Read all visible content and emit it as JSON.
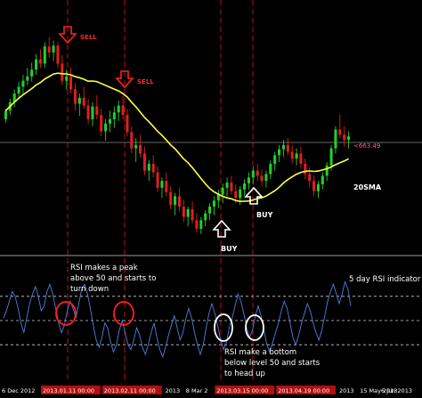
{
  "chart_data": {
    "type": "line",
    "instrument_last_price_label": "<663.49",
    "price_panel": {
      "series": [
        {
          "name": "20SMA",
          "color": "#ffff40"
        }
      ],
      "candles": [
        [
          470,
          482,
          466,
          480
        ],
        [
          480,
          494,
          475,
          490
        ],
        [
          490,
          505,
          484,
          500
        ],
        [
          500,
          514,
          495,
          508
        ],
        [
          508,
          522,
          500,
          515
        ],
        [
          515,
          530,
          510,
          520
        ],
        [
          520,
          536,
          514,
          528
        ],
        [
          528,
          546,
          522,
          540
        ],
        [
          540,
          552,
          530,
          535
        ],
        [
          535,
          560,
          530,
          555
        ],
        [
          555,
          566,
          542,
          548
        ],
        [
          548,
          562,
          538,
          556
        ],
        [
          556,
          560,
          530,
          535
        ],
        [
          535,
          545,
          510,
          515
        ],
        [
          515,
          528,
          505,
          520
        ],
        [
          520,
          530,
          500,
          505
        ],
        [
          505,
          512,
          480,
          488
        ],
        [
          488,
          500,
          474,
          495
        ],
        [
          495,
          508,
          482,
          486
        ],
        [
          486,
          494,
          465,
          470
        ],
        [
          470,
          490,
          462,
          485
        ],
        [
          485,
          498,
          470,
          475
        ],
        [
          475,
          482,
          450,
          456
        ],
        [
          456,
          470,
          445,
          465
        ],
        [
          465,
          480,
          455,
          470
        ],
        [
          470,
          485,
          460,
          478
        ],
        [
          478,
          492,
          468,
          486
        ],
        [
          486,
          497,
          470,
          475
        ],
        [
          475,
          482,
          450,
          455
        ],
        [
          455,
          462,
          430,
          436
        ],
        [
          436,
          448,
          420,
          440
        ],
        [
          440,
          452,
          425,
          430
        ],
        [
          430,
          438,
          405,
          410
        ],
        [
          410,
          422,
          398,
          418
        ],
        [
          418,
          428,
          402,
          408
        ],
        [
          408,
          415,
          385,
          390
        ],
        [
          390,
          402,
          378,
          398
        ],
        [
          398,
          408,
          380,
          385
        ],
        [
          385,
          392,
          365,
          370
        ],
        [
          370,
          384,
          358,
          380
        ],
        [
          380,
          390,
          362,
          368
        ],
        [
          368,
          376,
          350,
          356
        ],
        [
          356,
          368,
          345,
          365
        ],
        [
          365,
          374,
          348,
          352
        ],
        [
          352,
          360,
          338,
          342
        ],
        [
          342,
          356,
          336,
          352
        ],
        [
          352,
          364,
          345,
          360
        ],
        [
          360,
          372,
          352,
          368
        ],
        [
          368,
          380,
          358,
          375
        ],
        [
          375,
          388,
          366,
          382
        ],
        [
          382,
          395,
          372,
          390
        ],
        [
          390,
          402,
          380,
          396
        ],
        [
          396,
          404,
          382,
          386
        ],
        [
          386,
          394,
          372,
          378
        ],
        [
          378,
          392,
          370,
          388
        ],
        [
          388,
          400,
          380,
          395
        ],
        [
          395,
          408,
          388,
          402
        ],
        [
          402,
          415,
          394,
          410
        ],
        [
          410,
          418,
          398,
          404
        ],
        [
          404,
          412,
          392,
          398
        ],
        [
          398,
          410,
          390,
          406
        ],
        [
          406,
          422,
          400,
          418
        ],
        [
          418,
          432,
          410,
          428
        ],
        [
          428,
          440,
          420,
          435
        ],
        [
          435,
          446,
          426,
          440
        ],
        [
          440,
          448,
          428,
          432
        ],
        [
          432,
          440,
          418,
          424
        ],
        [
          424,
          436,
          416,
          430
        ],
        [
          430,
          438,
          412,
          418
        ],
        [
          418,
          424,
          400,
          406
        ],
        [
          406,
          414,
          390,
          398
        ],
        [
          398,
          404,
          380,
          386
        ],
        [
          386,
          398,
          378,
          394
        ],
        [
          394,
          408,
          388,
          404
        ],
        [
          404,
          420,
          398,
          416
        ],
        [
          416,
          440,
          410,
          436
        ],
        [
          436,
          462,
          430,
          458
        ],
        [
          458,
          475,
          448,
          452
        ],
        [
          452,
          462,
          438,
          446
        ],
        [
          446,
          456,
          436,
          450
        ]
      ]
    },
    "rsi_panel": {
      "series": [
        {
          "name": "5 day RSI indicator",
          "color": "#4f7fe0"
        }
      ],
      "levels": [
        70,
        50,
        30
      ],
      "values": [
        52,
        58,
        66,
        74,
        70,
        60,
        48,
        40,
        52,
        64,
        72,
        78,
        70,
        58,
        62,
        74,
        80,
        72,
        60,
        48,
        40,
        46,
        58,
        66,
        60,
        52,
        64,
        76,
        80,
        72,
        60,
        46,
        34,
        28,
        36,
        48,
        44,
        32,
        24,
        30,
        42,
        50,
        40,
        30,
        26,
        34,
        44,
        38,
        28,
        22,
        30,
        40,
        48,
        36,
        26,
        20,
        28,
        38,
        46,
        54,
        44,
        34,
        40,
        52,
        60,
        52,
        40,
        30,
        22,
        30,
        44,
        56,
        64,
        56,
        46,
        34,
        26,
        32,
        44,
        52,
        62,
        72,
        66,
        56,
        44,
        36,
        42,
        54,
        62,
        54,
        42,
        30,
        24,
        32,
        40,
        48,
        58,
        66,
        60,
        48,
        36,
        30,
        38,
        48,
        56,
        64,
        58,
        48,
        40,
        34,
        42,
        54,
        66,
        74,
        80,
        72,
        64,
        72,
        82,
        76,
        62
      ]
    },
    "x_tick_labels": [
      {
        "label": "6 Dec 2012",
        "highlight": false
      },
      {
        "label": "2013.01.11 00:00",
        "highlight": true
      },
      {
        "label": "2013.02.11 00:00",
        "highlight": true
      },
      {
        "label": "2013",
        "highlight": false
      },
      {
        "label": "8 Mar 2",
        "highlight": false
      },
      {
        "label": "2013.03.15 00:00",
        "highlight": true
      },
      {
        "label": "2013.04.19 00:00",
        "highlight": true
      },
      {
        "label": "2013",
        "highlight": false
      },
      {
        "label": "15 May 2013",
        "highlight": false
      },
      {
        "label": "6 Jun 2013",
        "highlight": false
      }
    ]
  },
  "annotations": {
    "sell_1": "SELL",
    "sell_2": "SELL",
    "buy_1": "BUY",
    "buy_2": "BUY",
    "sma_label": "20SMA",
    "rsi_peak_note": [
      "RSI makes a peak",
      "above 50 and starts to",
      "turn down"
    ],
    "rsi_bottom_note": [
      "RSI make a bottom",
      "below level 50 and starts",
      "to head up"
    ],
    "rsi_indicator_label": "5 day RSI indicator"
  },
  "colors": {
    "background": "#000000",
    "bull": "#21d12a",
    "bear": "#e01f1f",
    "sma": "#ffff40",
    "rsi": "#4f7fe0",
    "vline": "#c01010",
    "sell_arrow": "#ff2020",
    "circle_sell": "#ff2020",
    "circle_buy": "#ffffff",
    "highlight_tick_bg": "#b01010"
  }
}
